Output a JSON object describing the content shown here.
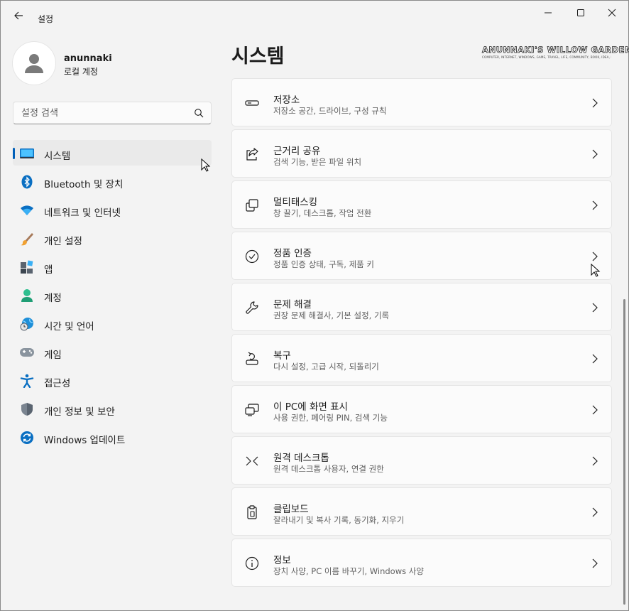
{
  "window": {
    "title": "설정"
  },
  "profile": {
    "name": "anunnaki",
    "account_type": "로컬 계정"
  },
  "search": {
    "placeholder": "설정 검색"
  },
  "nav": {
    "items": [
      {
        "label": "시스템",
        "icon": "monitor-icon",
        "selected": true
      },
      {
        "label": "Bluetooth 및 장치",
        "icon": "bluetooth-icon"
      },
      {
        "label": "네트워크 및 인터넷",
        "icon": "wifi-icon"
      },
      {
        "label": "개인 설정",
        "icon": "brush-icon"
      },
      {
        "label": "앱",
        "icon": "apps-icon"
      },
      {
        "label": "계정",
        "icon": "account-icon"
      },
      {
        "label": "시간 및 언어",
        "icon": "globe-clock-icon"
      },
      {
        "label": "게임",
        "icon": "gamepad-icon"
      },
      {
        "label": "접근성",
        "icon": "accessibility-icon"
      },
      {
        "label": "개인 정보 및 보안",
        "icon": "shield-icon"
      },
      {
        "label": "Windows 업데이트",
        "icon": "update-icon"
      }
    ]
  },
  "main": {
    "title": "시스템",
    "watermark": {
      "text": "ANUNNAKI'S WILLOW GARDEN",
      "subtext": "COMPUTER, INTERNET, WINDOWS, GAME, TRAVEL, LIFE, COMMUNITY, BOOK, IDEA, ETC"
    },
    "cards": [
      {
        "title": "저장소",
        "desc": "저장소 공간, 드라이브, 구성 규칙",
        "icon": "storage-drive-icon"
      },
      {
        "title": "근거리 공유",
        "desc": "검색 기능, 받은 파일 위치",
        "icon": "share-icon"
      },
      {
        "title": "멀티태스킹",
        "desc": "창 끌기, 데스크톱, 작업 전환",
        "icon": "multitasking-icon"
      },
      {
        "title": "정품 인증",
        "desc": "정품 인증 상태, 구독, 제품 키",
        "icon": "checkmark-circle-icon"
      },
      {
        "title": "문제 해결",
        "desc": "권장 문제 해결사, 기본 설정, 기록",
        "icon": "wrench-icon"
      },
      {
        "title": "복구",
        "desc": "다시 설정, 고급 시작, 되돌리기",
        "icon": "recovery-icon"
      },
      {
        "title": "이 PC에 화면 표시",
        "desc": "사용 권한, 페어링 PIN, 검색 기능",
        "icon": "project-screen-icon"
      },
      {
        "title": "원격 데스크톱",
        "desc": "원격 데스크톱 사용자, 연결 권한",
        "icon": "remote-desktop-icon"
      },
      {
        "title": "클립보드",
        "desc": "잘라내기 및 복사 기록, 동기화, 지우기",
        "icon": "clipboard-icon"
      },
      {
        "title": "정보",
        "desc": "장치 사양, PC 이름 바꾸기, Windows 사양",
        "icon": "info-icon"
      }
    ]
  },
  "colors": {
    "accent": "#005fb8",
    "background": "#f3f3f3",
    "card": "#fbfbfb"
  }
}
